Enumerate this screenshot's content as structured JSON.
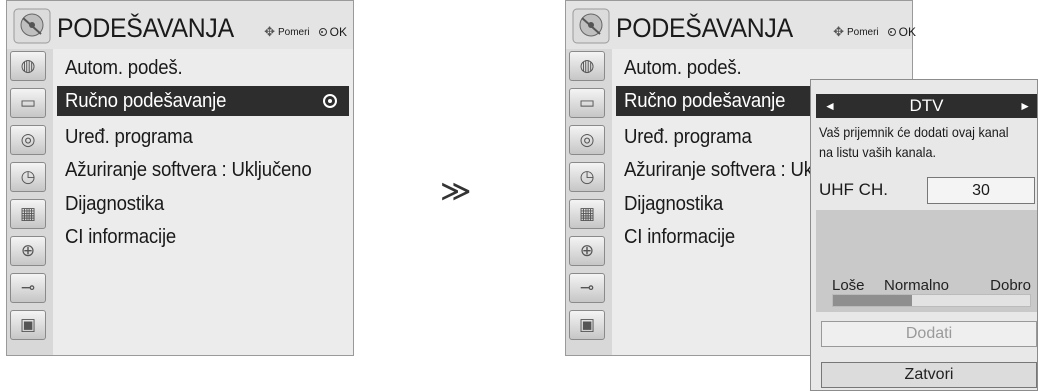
{
  "left_menu": {
    "title": "PODEŠAVANJA",
    "hint_move": "Pomeri",
    "hint_ok": "OK",
    "items": [
      {
        "label": "Autom. podeš."
      },
      {
        "label": "Ručno podešavanje",
        "selected": true
      },
      {
        "label": "Uređ. programa"
      },
      {
        "label": "Ažuriranje softvera : Uključeno"
      },
      {
        "label": "Dijagnostika"
      },
      {
        "label": "CI informacije"
      }
    ],
    "icons": [
      "antenna-icon",
      "tv-screen-icon",
      "speaker-icon",
      "clock-icon",
      "calendar-icon",
      "lock-icon",
      "plug-icon",
      "photo-icon"
    ]
  },
  "arrow": "≫",
  "right_menu": {
    "title": "PODEŠAVANJA",
    "hint_move": "Pomeri",
    "hint_ok": "OK",
    "items": [
      {
        "label": "Autom. podeš."
      },
      {
        "label": "Ručno podešavanje",
        "selected": true
      },
      {
        "label": "Uređ. programa"
      },
      {
        "label": "Ažuriranje softvera : Uk"
      },
      {
        "label": "Dijagnostika"
      },
      {
        "label": "CI informacije"
      }
    ]
  },
  "dialog": {
    "mode_left": "◄",
    "mode": "DTV",
    "mode_right": "►",
    "message_line1": "Vaš prijemnik će dodati ovaj kanal",
    "message_line2": "na listu vaših kanala.",
    "channel_label": "UHF CH.",
    "channel_value": "30",
    "signal_labels": {
      "bad": "Loše",
      "normal": "Normalno",
      "good": "Dobro"
    },
    "signal_level": 0.4,
    "add_button": "Dodati",
    "close_button": "Zatvori"
  }
}
